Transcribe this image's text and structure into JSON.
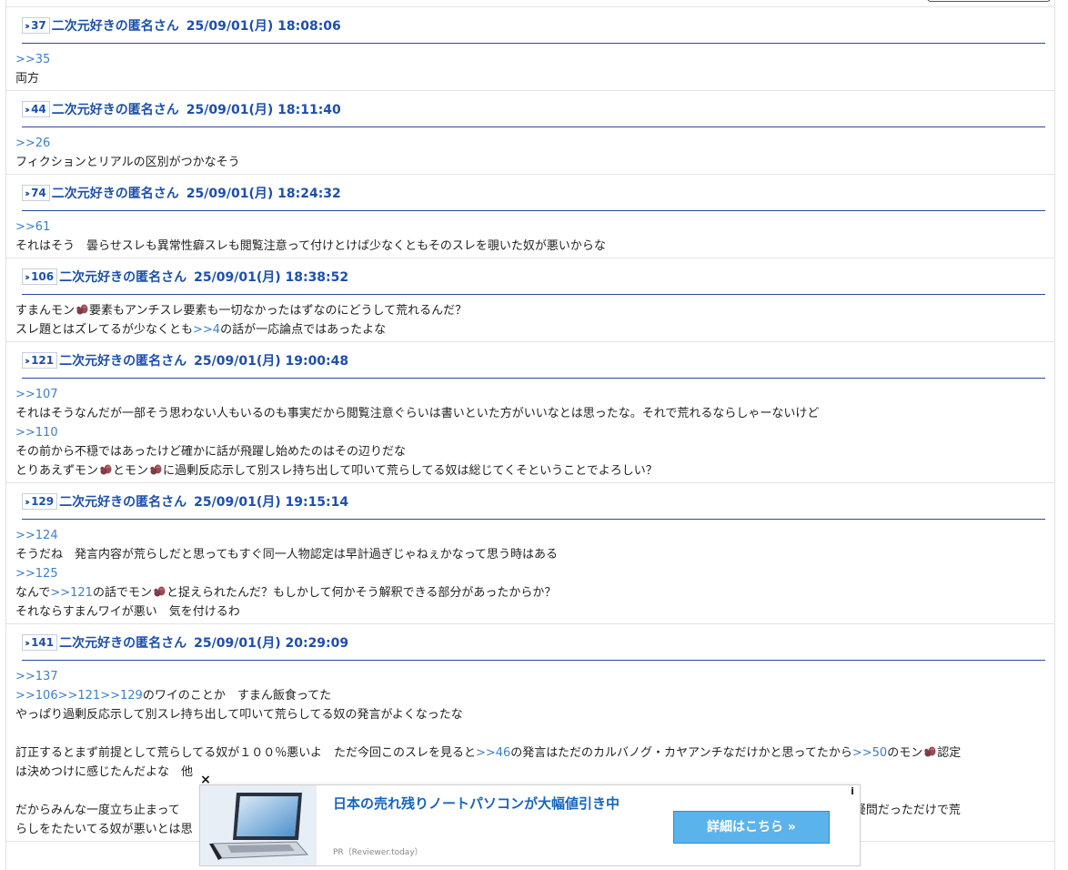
{
  "posts": [
    {
      "number": "37",
      "name": "二次元好きの匿名さん",
      "date": "25/09/01(月) 18:08:06",
      "lines": [
        [
          {
            "t": ">>35",
            "a": true
          }
        ],
        [
          {
            "t": "両方"
          }
        ]
      ]
    },
    {
      "number": "44",
      "name": "二次元好きの匿名さん",
      "date": "25/09/01(月) 18:11:40",
      "lines": [
        [
          {
            "t": ">>26",
            "a": true
          }
        ],
        [
          {
            "t": "フィクションとリアルの区別がつかなそう"
          }
        ]
      ]
    },
    {
      "number": "74",
      "name": "二次元好きの匿名さん",
      "date": "25/09/01(月) 18:24:32",
      "lines": [
        [
          {
            "t": ">>61",
            "a": true
          }
        ],
        [
          {
            "t": "それはそう　曇らせスレも異常性癖スレも閲覧注意って付けとけば少なくともそのスレを覗いた奴が悪いからな"
          }
        ]
      ]
    },
    {
      "number": "106",
      "name": "二次元好きの匿名さん",
      "date": "25/09/01(月) 18:38:52",
      "lines": [
        [
          {
            "t": "すまんモン"
          },
          {
            "e": true
          },
          {
            "t": "要素もアンチスレ要素も一切なかったはずなのにどうして荒れるんだ？"
          }
        ],
        [
          {
            "t": "スレ題とはズレてるが少なくとも"
          },
          {
            "t": ">>4",
            "a": true
          },
          {
            "t": "の話が一応論点ではあったよな"
          }
        ]
      ]
    },
    {
      "number": "121",
      "name": "二次元好きの匿名さん",
      "date": "25/09/01(月) 19:00:48",
      "lines": [
        [
          {
            "t": ">>107",
            "a": true
          }
        ],
        [
          {
            "t": "それはそうなんだが一部そう思わない人もいるのも事実だから閲覧注意ぐらいは書いといた方がいいなとは思ったな。それで荒れるならしゃーないけど"
          }
        ],
        [
          {
            "t": ">>110",
            "a": true
          }
        ],
        [
          {
            "t": "その前から不穏ではあったけど確かに話が飛躍し始めたのはその辺りだな"
          }
        ],
        [
          {
            "t": "とりあえずモン"
          },
          {
            "e": true
          },
          {
            "t": "とモン"
          },
          {
            "e": true
          },
          {
            "t": "に過剰反応示して別スレ持ち出して叩いて荒らしてる奴は総じてくそということでよろしい？"
          }
        ]
      ]
    },
    {
      "number": "129",
      "name": "二次元好きの匿名さん",
      "date": "25/09/01(月) 19:15:14",
      "lines": [
        [
          {
            "t": ">>124",
            "a": true
          }
        ],
        [
          {
            "t": "そうだね　発言内容が荒らしだと思ってもすぐ同一人物認定は早計過ぎじゃねぇかなって思う時はある"
          }
        ],
        [
          {
            "t": ">>125",
            "a": true
          }
        ],
        [
          {
            "t": "なんで"
          },
          {
            "t": ">>121",
            "a": true
          },
          {
            "t": "の話でモン"
          },
          {
            "e": true
          },
          {
            "t": "と捉えられたんだ？もしかして何かそう解釈できる部分があったからか？"
          }
        ],
        [
          {
            "t": "それならすまんワイが悪い　気を付けるわ"
          }
        ]
      ]
    },
    {
      "number": "141",
      "name": "二次元好きの匿名さん",
      "date": "25/09/01(月) 20:29:09",
      "lines": [
        [
          {
            "t": ">>137",
            "a": true
          }
        ],
        [
          {
            "t": ">>106",
            "a": true
          },
          {
            "t": ">>121",
            "a": true
          },
          {
            "t": ">>129",
            "a": true
          },
          {
            "t": "のワイのことか　すまん飯食ってた"
          }
        ],
        [
          {
            "t": "やっぱり過剰反応示して別スレ持ち出して叩いて荒らしてる奴の発言がよくなったな"
          }
        ],
        [],
        [
          {
            "t": "訂正するとまず前提として荒らしてる奴が１００％悪いよ　ただ今回このスレを見ると"
          },
          {
            "t": ">>46",
            "a": true
          },
          {
            "t": "の発言はただのカルバノグ・カヤアンチなだけかと思ってたから"
          },
          {
            "t": ">>50",
            "a": true
          },
          {
            "t": "のモン"
          },
          {
            "e": true
          },
          {
            "t": "認定"
          }
        ],
        [
          {
            "t": "は決めつけに感じたんだよな　他"
          }
        ],
        [],
        [
          {
            "t": "だからみんな一度立ち止まって"
          },
          {
            "t": "　　　　　　　　　　　　　　　　　　　　　　　　　　　　　　　　　　　　　　　　　　　　　　　　　　　つくのか？と疑問だっただけで荒"
          }
        ],
        [
          {
            "t": "らしをたたいてる奴が悪いとは思"
          }
        ]
      ]
    }
  ],
  "ad": {
    "close": "×",
    "info": "i",
    "title": "日本の売れ残りノートパソコンが大幅値引き中",
    "cta": "詳細はこちら »",
    "sponsor": "PR（Reviewer.today）",
    "accent": "#5bb3ec"
  },
  "colors": {
    "anchor": "#3d7fd0",
    "header": "#1c4fb0",
    "rule": "#2b4b9b"
  }
}
